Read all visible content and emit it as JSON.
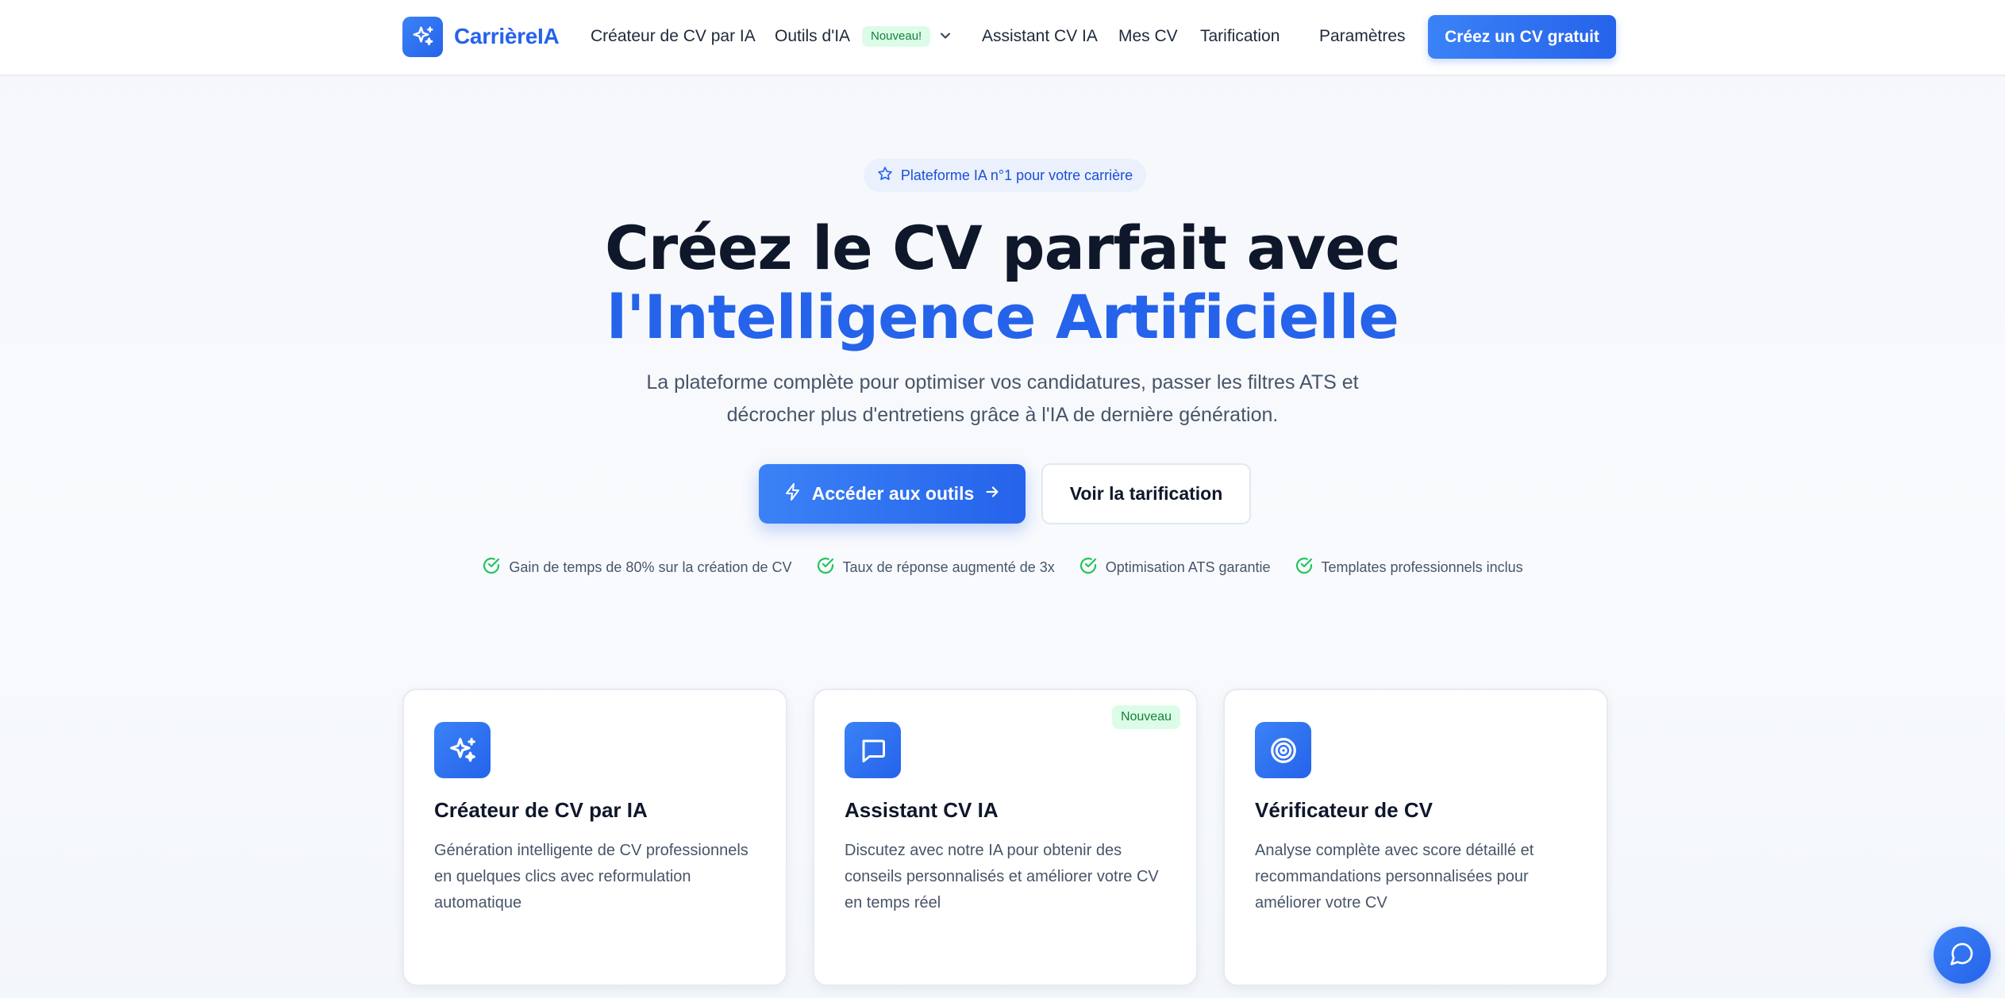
{
  "brand": {
    "name": "CarrièreIA"
  },
  "nav": {
    "items": [
      {
        "label": "Créateur de CV par IA"
      },
      {
        "label": "Outils d'IA",
        "badge": "Nouveau!"
      },
      {
        "label": "Assistant CV IA"
      },
      {
        "label": "Mes CV"
      },
      {
        "label": "Tarification"
      },
      {
        "label": "Paramètres"
      }
    ],
    "cta": "Créez un CV gratuit"
  },
  "hero": {
    "pill": "Plateforme IA n°1 pour votre carrière",
    "title_line1": "Créez le CV parfait avec",
    "title_line2": "l'Intelligence Artificielle",
    "subtitle": "La plateforme complète pour optimiser vos candidatures, passer les filtres ATS et décrocher plus d'entretiens grâce à l'IA de dernière génération.",
    "primary_button": "Accéder aux outils",
    "secondary_button": "Voir la tarification",
    "benefits": [
      "Gain de temps de 80% sur la création de CV",
      "Taux de réponse augmenté de 3x",
      "Optimisation ATS garantie",
      "Templates professionnels inclus"
    ]
  },
  "features": [
    {
      "title": "Créateur de CV par IA",
      "description": "Génération intelligente de CV professionnels en quelques clics avec reformulation automatique",
      "icon": "sparkles-icon"
    },
    {
      "title": "Assistant CV IA",
      "description": "Discutez avec notre IA pour obtenir des conseils personnalisés et améliorer votre CV en temps réel",
      "icon": "chat-icon",
      "badge": "Nouveau"
    },
    {
      "title": "Vérificateur de CV",
      "description": "Analyse complète avec score détaillé et recommandations personnalisées pour améliorer votre CV",
      "icon": "target-icon"
    }
  ],
  "colors": {
    "primary": "#2563eb",
    "primary_light": "#3b82f6",
    "success": "#22c55e",
    "badge_bg": "#dcfce7",
    "text_dark": "#0f172a",
    "text_muted": "#475569"
  }
}
